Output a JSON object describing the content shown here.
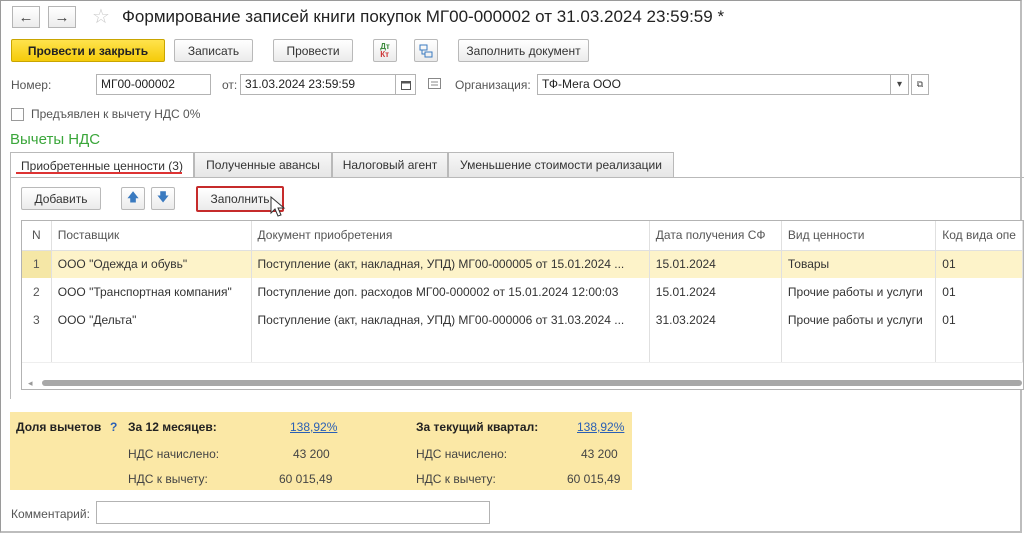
{
  "header": {
    "back": "←",
    "forward": "→",
    "title": "Формирование записей книги покупок МГ00-000002 от 31.03.2024 23:59:59 *"
  },
  "toolbar": {
    "post_close": "Провести и закрыть",
    "save": "Записать",
    "post": "Провести",
    "dt_icon_top": "Дт",
    "dt_icon_bottom": "Кт",
    "fill_document": "Заполнить документ"
  },
  "form": {
    "number_label": "Номер:",
    "number_value": "МГ00-000002",
    "date_label": "от:",
    "date_value": "31.03.2024 23:59:59",
    "org_label": "Организация:",
    "org_value": "ТФ-Мега ООО",
    "vat0_label": "Предъявлен к вычету НДС 0%",
    "vat0_checked": false
  },
  "section_title": "Вычеты НДС",
  "tabs": [
    {
      "label": "Приобретенные ценности (3)",
      "active": true
    },
    {
      "label": "Полученные авансы",
      "active": false
    },
    {
      "label": "Налоговый агент",
      "active": false
    },
    {
      "label": "Уменьшение стоимости реализации",
      "active": false
    }
  ],
  "tab_toolbar": {
    "add": "Добавить",
    "up": "🡅",
    "down": "🡇",
    "fill": "Заполнить"
  },
  "grid": {
    "columns": [
      "N",
      "Поставщик",
      "Документ приобретения",
      "Дата получения СФ",
      "Вид ценности",
      "Код вида опе"
    ],
    "rows": [
      [
        "1",
        "ООО \"Одежда и обувь\"",
        "Поступление (акт, накладная, УПД) МГ00-000005 от 15.01.2024 ...",
        "15.01.2024",
        "Товары",
        "01"
      ],
      [
        "2",
        "ООО \"Транспортная компания\"",
        "Поступление доп. расходов МГ00-000002 от 15.01.2024 12:00:03",
        "15.01.2024",
        "Прочие работы и услуги",
        "01"
      ],
      [
        "3",
        "ООО \"Дельта\"",
        "Поступление (акт, накладная, УПД) МГ00-000006 от 31.03.2024 ...",
        "31.03.2024",
        "Прочие работы и услуги",
        "01"
      ]
    ],
    "selected_row": 0
  },
  "summary": {
    "share_label": "Доля вычетов",
    "help": "?",
    "months12_label": "За 12 месяцев:",
    "months12_value": "138,92%",
    "quarter_label": "За текущий квартал:",
    "quarter_value": "138,92%",
    "accrued_label": "НДС начислено:",
    "accrued_12": "43 200",
    "accrued_q": "43 200",
    "deduct_label": "НДС к вычету:",
    "deduct_12": "60 015,49",
    "deduct_q": "60 015,49"
  },
  "comment": {
    "label": "Комментарий:",
    "value": ""
  },
  "colors": {
    "primary_button": "#f5cb0a",
    "section_title": "#3aa63a",
    "selected_row": "#fdf3c9",
    "summary_bg": "#fbe8a6",
    "highlight_red": "#d33333"
  }
}
